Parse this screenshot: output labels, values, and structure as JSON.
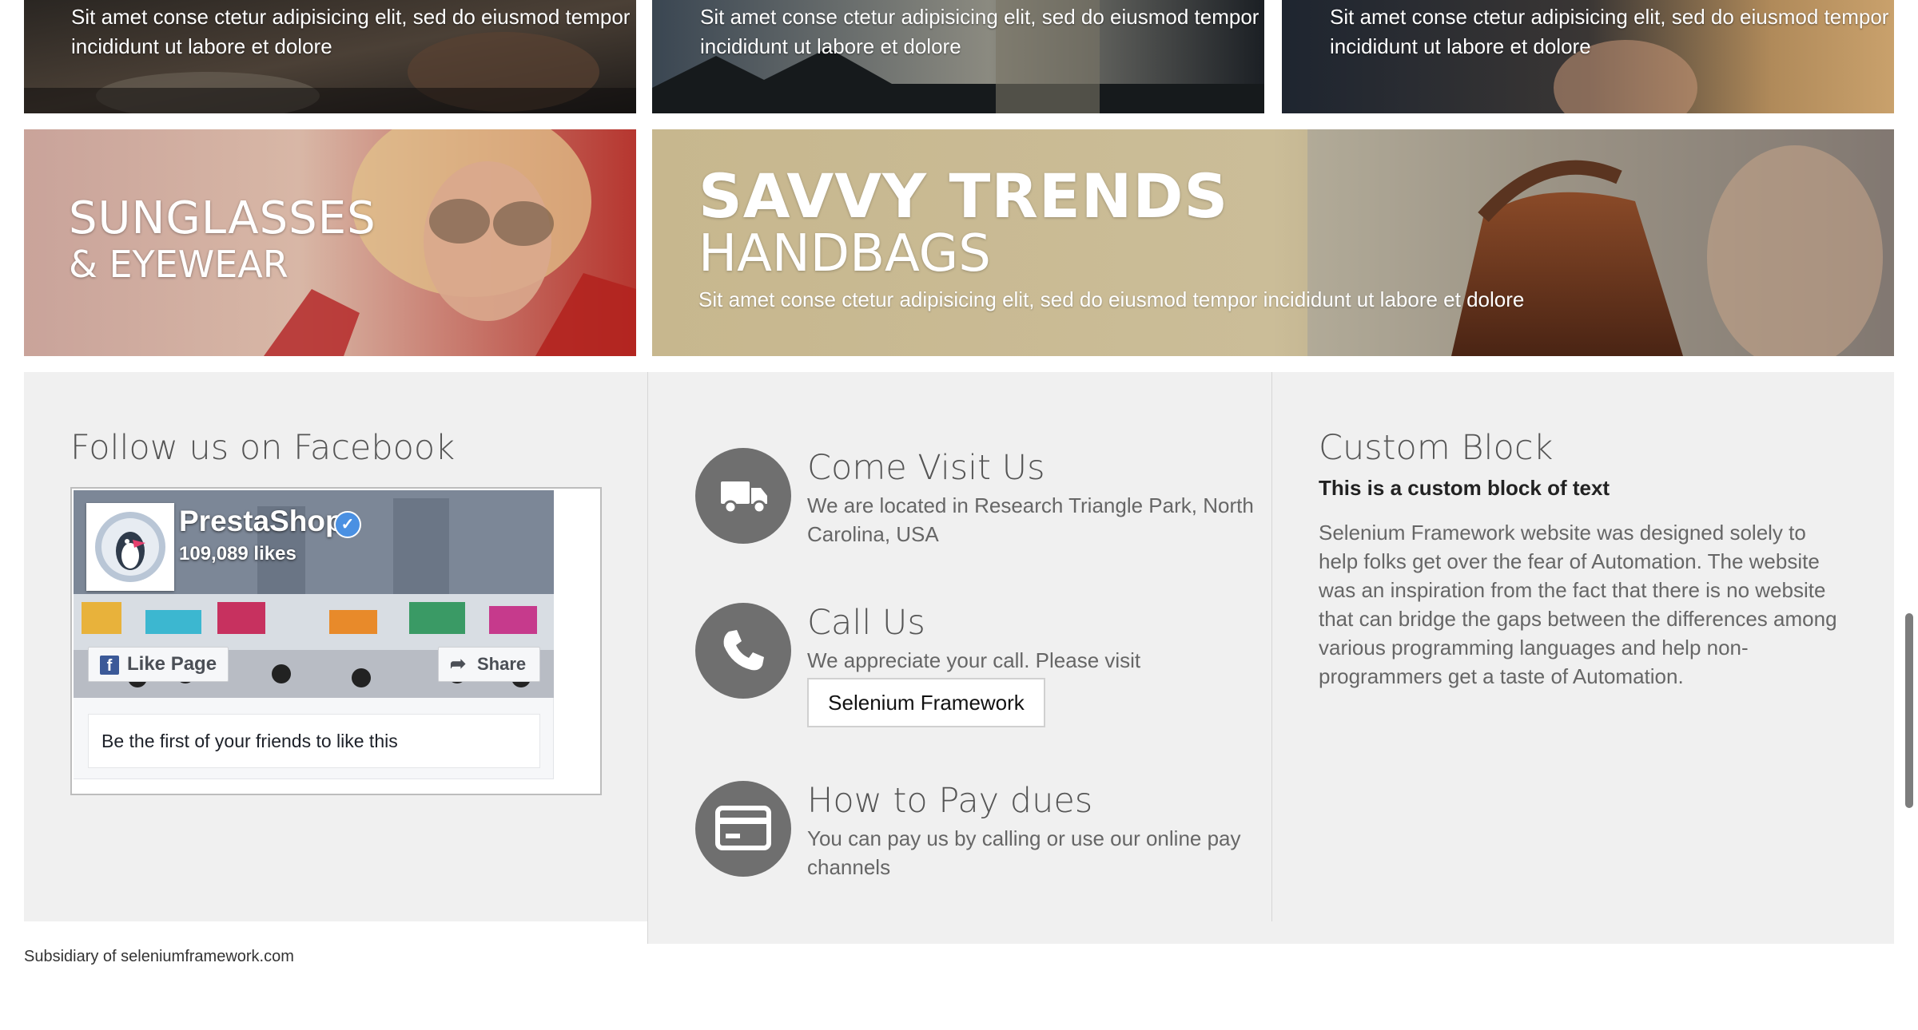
{
  "banners": {
    "top": [
      {
        "caption": "Sit amet conse ctetur adipisicing elit, sed do eiusmod tempor incididunt ut labore et dolore"
      },
      {
        "caption": "Sit amet conse ctetur adipisicing elit, sed do eiusmod tempor incididunt ut labore et dolore"
      },
      {
        "caption": "Sit amet conse ctetur adipisicing elit, sed do eiusmod tempor incididunt ut labore et dolore"
      }
    ],
    "sunglasses": {
      "title": "SUNGLASSES",
      "subtitle": "& EYEWEAR"
    },
    "handbags": {
      "title": "SAVVY TRENDS",
      "subtitle": "HANDBAGS",
      "caption": "Sit amet conse ctetur adipisicing elit, sed do eiusmod tempor incididunt ut labore et dolore"
    }
  },
  "facebook": {
    "heading": "Follow us on Facebook",
    "page_name": "PrestaShop",
    "likes": "109,089 likes",
    "like_button": "Like Page",
    "share_button": "Share",
    "friends_text": "Be the first of your friends to like this",
    "accent": "#3b5998"
  },
  "contact": [
    {
      "icon": "truck-icon",
      "title": "Come Visit Us",
      "text": "We are located in Research Triangle Park, North Carolina, USA"
    },
    {
      "icon": "phone-icon",
      "title": "Call Us",
      "text": "We appreciate your call. Please visit",
      "button": "Selenium Framework"
    },
    {
      "icon": "credit-card-icon",
      "title": "How to Pay dues",
      "text": "You can pay us by calling or use our online pay channels"
    }
  ],
  "custom_block": {
    "heading": "Custom Block",
    "subheading": "This is a custom block of text",
    "body": "Selenium Framework website was designed solely to help folks get over the fear of Automation. The website was an inspiration from the fact that there is no website that can bridge the gaps between the differences among various programming languages and help non-programmers get a taste of Automation."
  },
  "footer_note": "Subsidiary of seleniumframework.com",
  "colors": {
    "footer_bg": "#f0f0f0",
    "icon_circle": "#6f6f6f"
  }
}
